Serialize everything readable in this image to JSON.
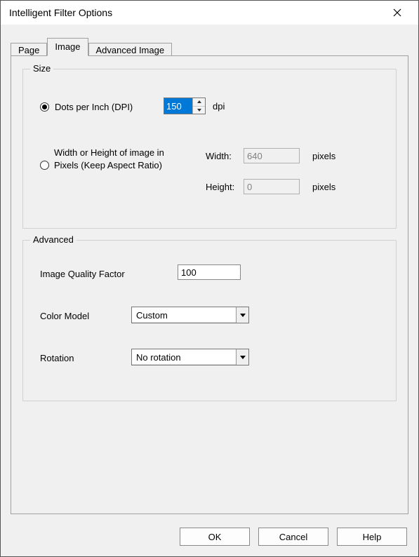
{
  "window": {
    "title": "Intelligent Filter Options"
  },
  "tabs": {
    "page": "Page",
    "image": "Image",
    "advanced_image": "Advanced Image"
  },
  "size": {
    "legend": "Size",
    "dpi_label": "Dots per Inch (DPI)",
    "dpi_value": "150",
    "dpi_unit": "dpi",
    "pixels_label": "Width or Height of image in Pixels (Keep Aspect Ratio)",
    "width_label": "Width:",
    "width_value": "640",
    "height_label": "Height:",
    "height_value": "0",
    "pixels_unit_w": "pixels",
    "pixels_unit_h": "pixels"
  },
  "advanced": {
    "legend": "Advanced",
    "quality_label": "Image Quality Factor",
    "quality_value": "100",
    "color_label": "Color Model",
    "color_value": "Custom",
    "rotation_label": "Rotation",
    "rotation_value": "No rotation"
  },
  "buttons": {
    "ok": "OK",
    "cancel": "Cancel",
    "help": "Help"
  }
}
